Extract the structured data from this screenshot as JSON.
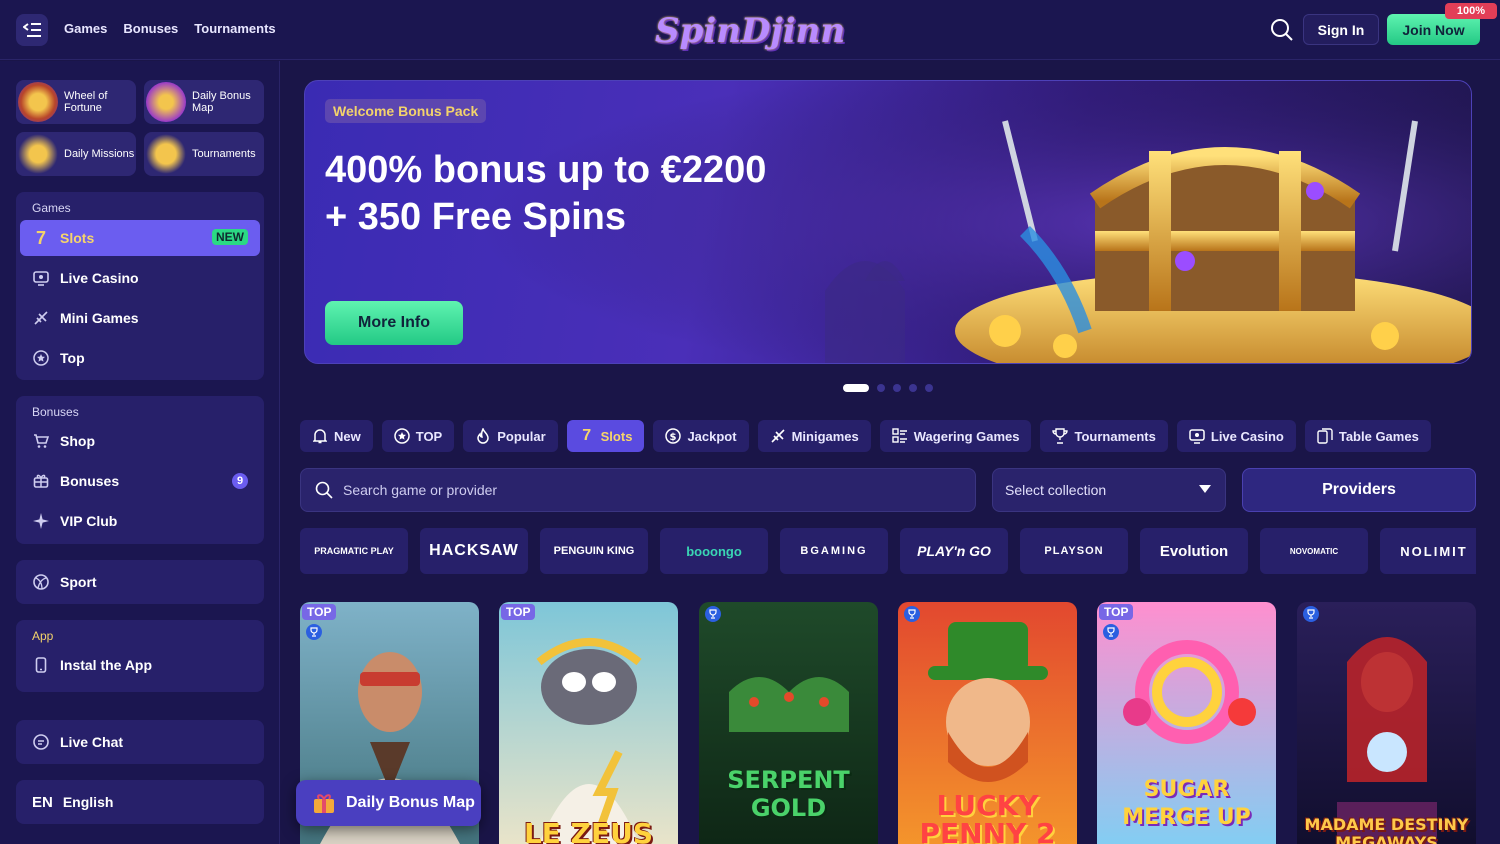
{
  "header": {
    "nav": [
      "Games",
      "Bonuses",
      "Tournaments"
    ],
    "logo_text": "SpinDjinn",
    "signin_label": "Sign In",
    "join_label": "Join Now",
    "join_badge": "100%"
  },
  "sidebar": {
    "promos": [
      "Wheel of Fortune",
      "Daily Bonus Map",
      "Daily Missions",
      "Tournaments"
    ],
    "games_title": "Games",
    "games": [
      {
        "label": "Slots",
        "badge": "NEW",
        "icon": "seven-icon"
      },
      {
        "label": "Live Casino",
        "icon": "live-casino-icon"
      },
      {
        "label": "Mini Games",
        "icon": "plane-icon"
      },
      {
        "label": "Top",
        "icon": "star-icon"
      }
    ],
    "bonuses_title": "Bonuses",
    "bonuses": [
      {
        "label": "Shop",
        "icon": "cart-icon"
      },
      {
        "label": "Bonuses",
        "count": "9",
        "icon": "gift-icon"
      },
      {
        "label": "VIP Club",
        "icon": "sparkle-icon"
      }
    ],
    "sport_label": "Sport",
    "app_title": "App",
    "app_label": "Instal the App",
    "live_chat_label": "Live Chat",
    "lang_code": "EN",
    "lang_label": "English"
  },
  "hero": {
    "badge": "Welcome Bonus Pack",
    "title_line1": "400% bonus up to €2200",
    "title_line2": "+ 350 Free Spins",
    "button": "More Info",
    "slides": 5,
    "active_slide": 1
  },
  "categories": [
    {
      "label": "New",
      "icon": "bell-icon"
    },
    {
      "label": "TOP",
      "icon": "star-icon"
    },
    {
      "label": "Popular",
      "icon": "fire-icon"
    },
    {
      "label": "Slots",
      "icon": "seven-icon",
      "active": true
    },
    {
      "label": "Jackpot",
      "icon": "coin-icon"
    },
    {
      "label": "Minigames",
      "icon": "plane-icon"
    },
    {
      "label": "Wagering Games",
      "icon": "list-icon"
    },
    {
      "label": "Tournaments",
      "icon": "trophy-icon"
    },
    {
      "label": "Live Casino",
      "icon": "live-casino-icon"
    },
    {
      "label": "Table Games",
      "icon": "cards-icon"
    }
  ],
  "search": {
    "placeholder": "Search game or provider"
  },
  "collection": {
    "placeholder": "Select collection"
  },
  "providers_label": "Providers",
  "providers": [
    "PRAGMATIC PLAY",
    "HACKSAW",
    "PENGUIN KING",
    "booongo",
    "BGAMING",
    "PLAY'n GO",
    "PLAYSON",
    "Evolution",
    "NOVOMATIC",
    "NOLIMIT"
  ],
  "games": [
    {
      "title": "",
      "top": "TOP",
      "colors": [
        "#7fb2c8",
        "#3f6f78"
      ]
    },
    {
      "title": "LE ZEUS",
      "top": "TOP",
      "colors": [
        "#7ec6d8",
        "#f1e6c8"
      ]
    },
    {
      "title": "SERPENT GOLD",
      "colors": [
        "#1f4a2a",
        "#0d2414"
      ]
    },
    {
      "title": "LUCKY PENNY 2",
      "colors": [
        "#e2482f",
        "#f59a2b"
      ]
    },
    {
      "title": "SUGAR MERGE UP",
      "top": "TOP",
      "colors": [
        "#ff8fcf",
        "#7ad2f5"
      ]
    },
    {
      "title": "MADAME DESTINY MEGAWAYS",
      "colors": [
        "#2a1f5a",
        "#0f0d2a"
      ]
    }
  ],
  "daily_bonus_map_label": "Daily Bonus Map",
  "colors": {
    "accent": "#6b5df0",
    "green": "#2bd984",
    "gold": "#f3d36b"
  }
}
